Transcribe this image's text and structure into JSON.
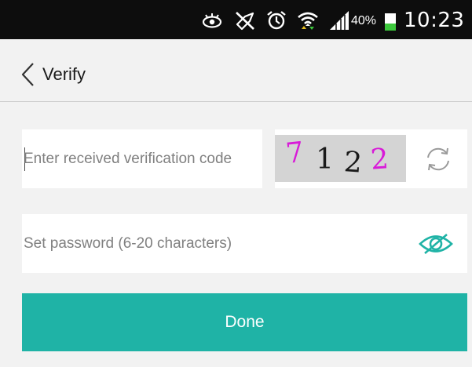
{
  "status_bar": {
    "battery_percent": "40%",
    "time": "10:23",
    "icons": [
      "eye-icon",
      "mute-icon",
      "alarm-icon",
      "wifi-icon",
      "signal-icon",
      "battery-icon"
    ]
  },
  "header": {
    "back_icon": "chevron-left-icon",
    "title": "Verify"
  },
  "verification": {
    "placeholder": "Enter received verification code",
    "captcha_text": [
      "7",
      "1",
      "2",
      "2"
    ],
    "captcha_colors": [
      "#d81bd8",
      "#1a1a1a",
      "#1a1a1a",
      "#d81bd8"
    ],
    "refresh_icon": "refresh-icon"
  },
  "password": {
    "placeholder": "Set password (6-20 characters)",
    "toggle_icon": "eye-slash-icon"
  },
  "done_button": {
    "label": "Done"
  },
  "colors": {
    "accent": "#1fb3a6",
    "background": "#f2f2f2",
    "status_bar": "#0d0d0d",
    "battery_fill": "#3cc83c"
  }
}
